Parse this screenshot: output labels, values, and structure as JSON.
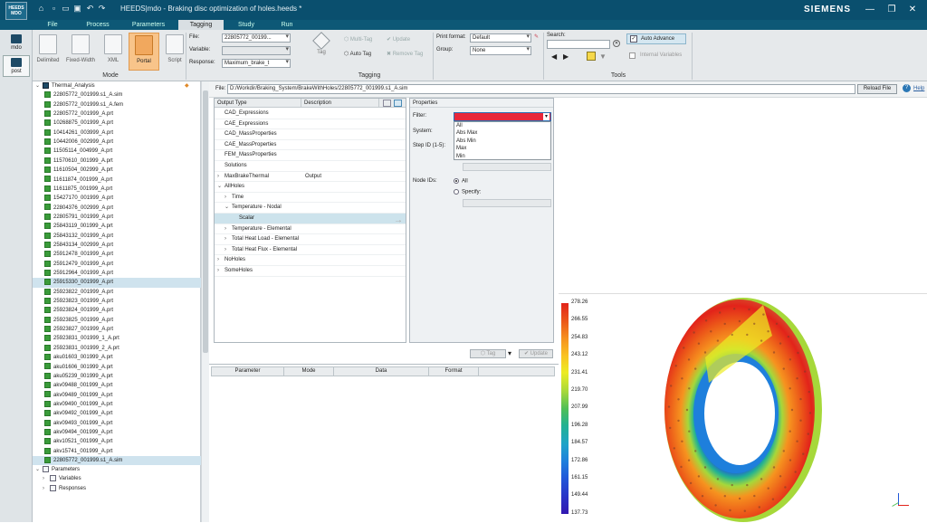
{
  "titlebar": {
    "app_badge_top": "HEEDS",
    "app_badge_bottom": "MDO",
    "title": "HEEDS|mdo - Braking disc optimization of holes.heeds *",
    "brand": "SIEMENS",
    "min": "—",
    "restore": "❐",
    "close": "✕"
  },
  "menu": [
    "File",
    "Process",
    "Parameters",
    "Tagging",
    "Study",
    "Run"
  ],
  "menu_active": "Tagging",
  "sidenav": {
    "mdo": "mdo",
    "post": "post"
  },
  "ribbon": {
    "mode_buttons": [
      "Delimited",
      "Fixed-Width",
      "XML",
      "Portal",
      "Script"
    ],
    "mode_selected": "Portal",
    "mode_group": "Mode",
    "file_label": "File:",
    "file_value": "22805772_00199...",
    "variable_label": "Variable:",
    "variable_value": "",
    "response_label": "Response:",
    "response_value": "Maximum_brake_t",
    "tag_label": "Tag",
    "multitag_label": "Multi-Tag",
    "autotag_label": "Auto Tag",
    "update_label": "Update",
    "removetag_label": "Remove Tag",
    "tagging_group": "Tagging",
    "printformat_label": "Print format:",
    "printformat_value": "Default",
    "group_label": "Group:",
    "group_value": "None",
    "search_label": "Search:",
    "search_value": "",
    "auto_advance_label": "Auto Advance",
    "internal_vars_label": "Internal Variables",
    "tools_group": "Tools"
  },
  "tree": {
    "root": "Thermal_Analysis",
    "files": [
      "22805772_001999.s1_A.sim",
      "22805772_001999.s1_A.fem",
      "22805772_001999_A.prt",
      "10268875_001999_A.prt",
      "10414261_003999_A.prt",
      "10442006_002999_A.prt",
      "11505114_004999_A.prt",
      "11570610_001999_A.prt",
      "11610504_002999_A.prt",
      "11611874_001999_A.prt",
      "11611875_001999_A.prt",
      "15427170_001999_A.prt",
      "22804376_002999_A.prt",
      "22805791_001999_A.prt",
      "25843119_001999_A.prt",
      "25843132_001999_A.prt",
      "25843134_002999_A.prt",
      "25912478_001999_A.prt",
      "25912479_001999_A.prt",
      "25912964_001999_A.prt",
      "25915330_001999_A.prt",
      "25923822_001999_A.prt",
      "25923823_001999_A.prt",
      "25923824_001999_A.prt",
      "25923825_001999_A.prt",
      "25923827_001999_A.prt",
      "25923831_001999_1_A.prt",
      "25923831_001999_2_A.prt",
      "aku01603_001999_A.prt",
      "aku01606_001999_A.prt",
      "aku05239_001999_A.prt",
      "akv09488_001999_A.prt",
      "akv09489_001999_A.prt",
      "akv09490_001999_A.prt",
      "akv09492_001999_A.prt",
      "akv09493_001999_A.prt",
      "akv09494_001999_A.prt",
      "akv10521_001999_A.prt",
      "akv15741_001999_A.prt",
      "22805772_001999.s1_A.sim"
    ],
    "highlighted": [
      20,
      39
    ],
    "parameters": "Parameters",
    "variables": "Variables",
    "responses": "Responses"
  },
  "filebar": {
    "label": "File:",
    "path": "D:/Workdir/Braking_System/BrakeWithHoles/22805772_001999.s1_A.sim",
    "reload": "Reload File",
    "help": "Help"
  },
  "outputs": {
    "col_type": "Output Type",
    "col_desc": "Description",
    "rows": [
      {
        "indent": 0,
        "arrow": "",
        "label": "CAD_Expressions",
        "desc": ""
      },
      {
        "indent": 0,
        "arrow": "",
        "label": "CAE_Expressions",
        "desc": ""
      },
      {
        "indent": 0,
        "arrow": "",
        "label": "CAD_MassProperties",
        "desc": ""
      },
      {
        "indent": 0,
        "arrow": "",
        "label": "CAE_MassProperties",
        "desc": ""
      },
      {
        "indent": 0,
        "arrow": "",
        "label": "FEM_MassProperties",
        "desc": ""
      },
      {
        "indent": 0,
        "arrow": "",
        "label": "Solutions",
        "desc": ""
      },
      {
        "indent": 0,
        "arrow": "›",
        "label": "MaxBrakeThermal",
        "desc": "Output"
      },
      {
        "indent": 0,
        "arrow": "⌄",
        "label": "AllHoles",
        "desc": ""
      },
      {
        "indent": 1,
        "arrow": "›",
        "label": "Time",
        "desc": ""
      },
      {
        "indent": 1,
        "arrow": "⌄",
        "label": "Temperature - Nodal",
        "desc": ""
      },
      {
        "indent": 2,
        "arrow": "",
        "label": "Scalar",
        "desc": ""
      },
      {
        "indent": 1,
        "arrow": "›",
        "label": "Temperature - Elemental",
        "desc": ""
      },
      {
        "indent": 1,
        "arrow": "›",
        "label": "Total Heat Load - Elemental",
        "desc": ""
      },
      {
        "indent": 1,
        "arrow": "›",
        "label": "Total Heat Flux - Elemental",
        "desc": ""
      },
      {
        "indent": 0,
        "arrow": "›",
        "label": "NoHoles",
        "desc": ""
      },
      {
        "indent": 0,
        "arrow": "›",
        "label": "SomeHoles",
        "desc": ""
      }
    ],
    "selected_index": 10
  },
  "properties": {
    "header": "Properties",
    "filter_label": "Filter:",
    "filter_options": [
      "All",
      "Abs Max",
      "Abs Min",
      "Max",
      "Min"
    ],
    "system_label": "System:",
    "step_label": "Step ID (1-5):",
    "nodeids_label": "Node IDs:",
    "radio_all": "All",
    "radio_specify": "Specify:",
    "tag_btn": "Tag",
    "update_btn": "Update"
  },
  "grid": {
    "columns": [
      "Parameter",
      "Mode",
      "Data",
      "Format"
    ]
  },
  "legend": {
    "values": [
      "278.26",
      "266.55",
      "254.83",
      "243.12",
      "231.41",
      "219.70",
      "207.99",
      "196.28",
      "184.57",
      "172.86",
      "161.15",
      "149.44",
      "137.73"
    ],
    "colors": [
      "#e2231a",
      "#ec5a19",
      "#f6931f",
      "#f9c322",
      "#ecec23",
      "#a6d83a",
      "#4fbf55",
      "#22b292",
      "#1ea3c9",
      "#1e7fdc",
      "#2157d9",
      "#2a33c6",
      "#3318b0"
    ]
  },
  "colors": {
    "accent": "#0a4f6e",
    "selected_mode": "#f8c48a",
    "filter_red": "#e8283a"
  }
}
